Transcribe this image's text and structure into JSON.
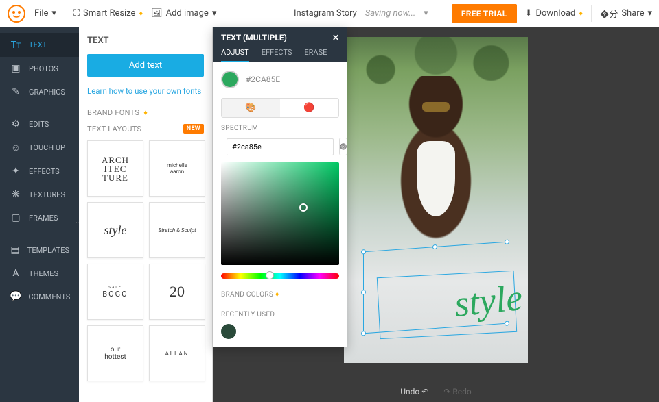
{
  "topbar": {
    "file": "File",
    "smart_resize": "Smart Resize",
    "add_image": "Add image",
    "doc_title": "Instagram Story",
    "saving": "Saving now...",
    "free_trial": "FREE TRIAL",
    "download": "Download",
    "share": "Share"
  },
  "sidebar": {
    "items": [
      {
        "label": "TEXT",
        "icon": "Tᴛ"
      },
      {
        "label": "PHOTOS",
        "icon": "▣"
      },
      {
        "label": "GRAPHICS",
        "icon": "✎"
      },
      {
        "label": "EDITS",
        "icon": "⚙"
      },
      {
        "label": "TOUCH UP",
        "icon": "☺"
      },
      {
        "label": "EFFECTS",
        "icon": "✦"
      },
      {
        "label": "TEXTURES",
        "icon": "❋"
      },
      {
        "label": "FRAMES",
        "icon": "▢"
      },
      {
        "label": "TEMPLATES",
        "icon": "▤"
      },
      {
        "label": "THEMES",
        "icon": "A"
      },
      {
        "label": "COMMENTS",
        "icon": "💬"
      }
    ]
  },
  "panel": {
    "title": "TEXT",
    "add_text": "Add text",
    "learn": "Learn how to use your own fonts",
    "brand_fonts": "BRAND FONTS",
    "text_layouts": "TEXT LAYOUTS",
    "new": "NEW",
    "layouts": [
      "ARCH\nITEC\nTURE",
      "michelle\naaron",
      "style",
      "Stretch & Sculpt",
      "BOGO",
      "20",
      "our\nhottest",
      "ALLAN"
    ]
  },
  "popup": {
    "title": "TEXT (MULTIPLE)",
    "tabs": [
      "ADJUST",
      "EFFECTS",
      "ERASE"
    ],
    "color_display": "#2CA85E",
    "spectrum": "SPECTRUM",
    "hex": "#2ca85e",
    "brand_colors": "BRAND COLORS",
    "recently_used": "RECENTLY USED"
  },
  "canvas": {
    "style_text": "style",
    "undo": "Undo",
    "redo": "Redo"
  },
  "colors": {
    "accent": "#2ca85e"
  }
}
